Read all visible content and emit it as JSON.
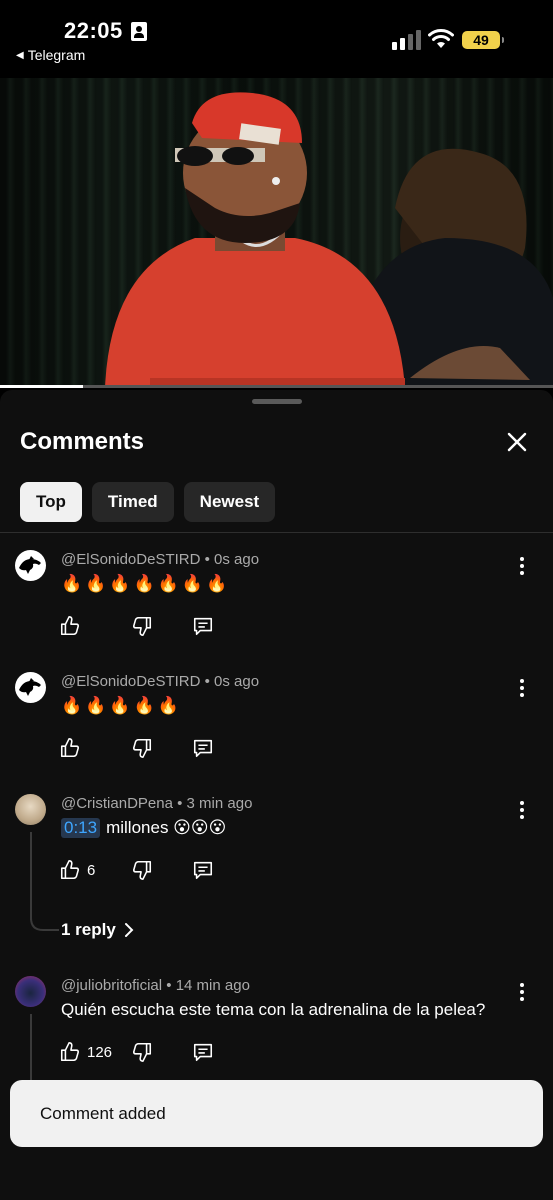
{
  "status_bar": {
    "time": "22:05",
    "back_app": "Telegram",
    "battery": "49",
    "battery_color": "#f1d14b"
  },
  "video": {
    "progress": 0.15
  },
  "comments_sheet": {
    "title": "Comments",
    "tabs": [
      {
        "label": "Top",
        "active": true
      },
      {
        "label": "Timed",
        "active": false
      },
      {
        "label": "Newest",
        "active": false
      }
    ],
    "comments": [
      {
        "author": "@ElSonidoDeSTIRD",
        "age": "0s ago",
        "text": "🔥🔥🔥🔥🔥🔥🔥",
        "likes": "",
        "avatar_icon": "horse-logo-icon"
      },
      {
        "author": "@ElSonidoDeSTIRD",
        "age": "0s ago",
        "text": "🔥🔥🔥🔥🔥",
        "likes": "",
        "avatar_icon": "horse-logo-icon"
      },
      {
        "author": "@CristianDPena",
        "age": "3 min ago",
        "timestamp": "0:13",
        "text": "millones 😮😮😮",
        "likes": "6",
        "replies": "1 reply"
      },
      {
        "author": "@juliobritoficial",
        "age": "14 min ago",
        "text": "Quién escucha este tema con la adrenalina de la pelea?",
        "likes": "126"
      }
    ]
  },
  "snackbar": {
    "message": "Comment added"
  },
  "colors": {
    "accent_link": "#3ea6ff",
    "sheet_bg": "#0f0f0f",
    "chip_bg": "#272727"
  }
}
